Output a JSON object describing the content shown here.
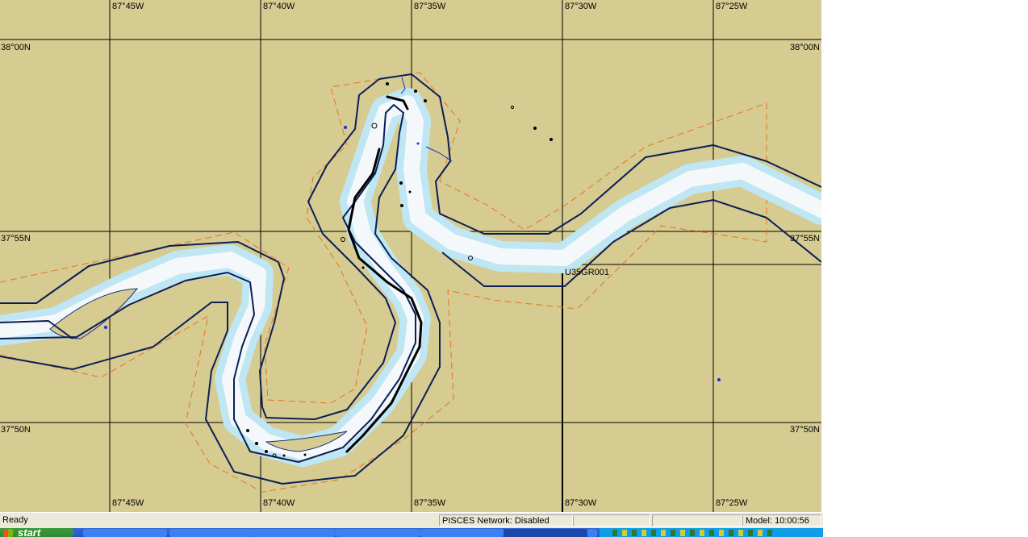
{
  "map": {
    "longitude_labels": [
      "87°45W",
      "87°40W",
      "87°35W",
      "87°30W",
      "87°25W"
    ],
    "latitude_labels": [
      "38°00N",
      "37°55N",
      "37°50N"
    ],
    "feature_label": "U35GR001",
    "colors": {
      "land": "#d6cb91",
      "water": "#f4f8fb",
      "shallow": "#bfe6f3",
      "channel_line": "#0b1f55",
      "boundary": "#e8731f",
      "grid": "#000000"
    }
  },
  "status": {
    "ready": "Ready",
    "network": "PISCES Network: Disabled",
    "model_time": "Model: 10:00:56"
  },
  "taskbar": {
    "start_label": "start"
  }
}
